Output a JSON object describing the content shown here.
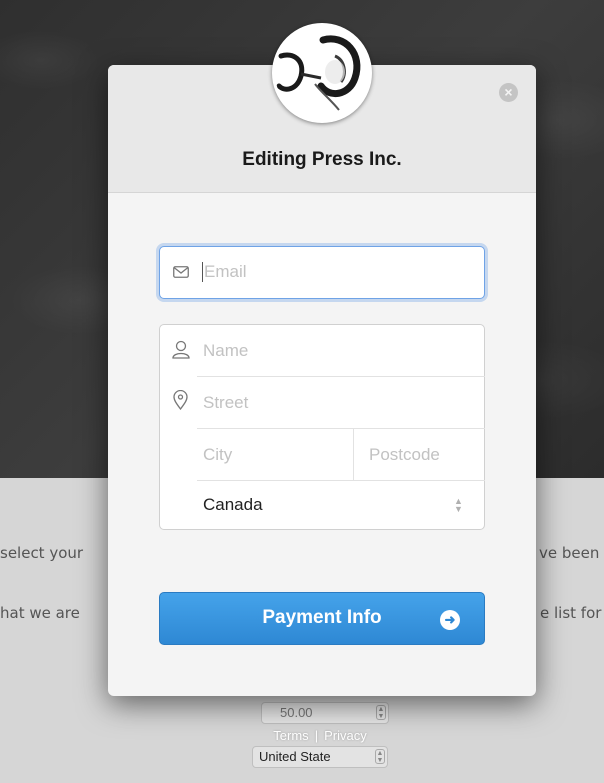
{
  "background": {
    "left_text_1": "select your",
    "right_text_1": "ve been",
    "left_text_2": "hat we are",
    "right_text_2": "e list for",
    "amount_value": "50.00",
    "country_value": "United State",
    "links": {
      "terms": "Terms",
      "separator": "|",
      "privacy": "Privacy"
    }
  },
  "modal": {
    "title": "Editing Press Inc.",
    "close_icon": "close-x",
    "email": {
      "placeholder": "Email",
      "icon": "envelope-icon"
    },
    "name": {
      "placeholder": "Name",
      "icon": "person-icon"
    },
    "street": {
      "placeholder": "Street",
      "icon": "location-pin-icon"
    },
    "city": {
      "placeholder": "City"
    },
    "postcode": {
      "placeholder": "Postcode"
    },
    "country": {
      "value": "Canada"
    },
    "payment_button": {
      "label": "Payment Info",
      "icon": "arrow-right-icon"
    }
  },
  "colors": {
    "button_blue": "#2e88d4",
    "focus_blue": "#6fa3e6",
    "header_gray": "#e8e8e8"
  }
}
